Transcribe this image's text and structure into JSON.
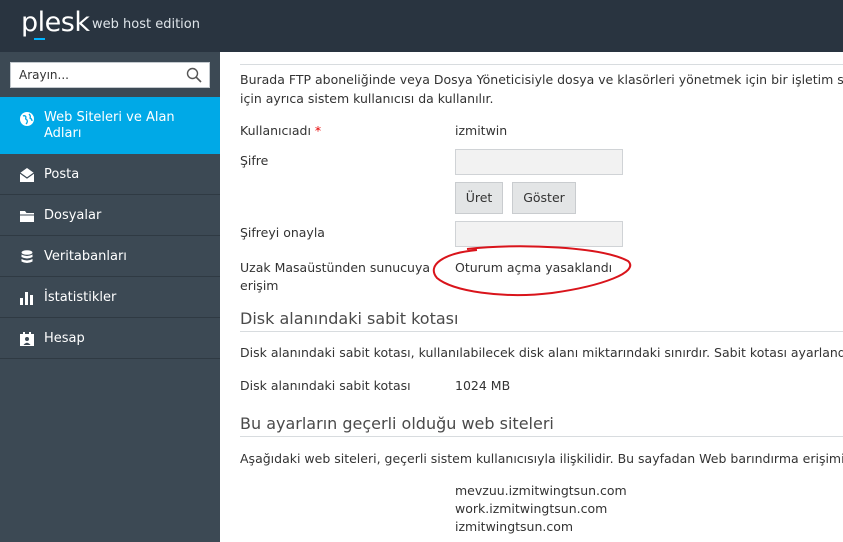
{
  "brand": {
    "logo": "plesk",
    "edition": "web host edition",
    "accent_color": "#00b3ff"
  },
  "sidebar": {
    "search_placeholder": "Arayın...",
    "items": [
      {
        "label": "Web Siteleri ve Alan Adları",
        "icon": "globe-icon",
        "active": true
      },
      {
        "label": "Posta",
        "icon": "mail-icon",
        "active": false
      },
      {
        "label": "Dosyalar",
        "icon": "folder-icon",
        "active": false
      },
      {
        "label": "Veritabanları",
        "icon": "database-icon",
        "active": false
      },
      {
        "label": "İstatistikler",
        "icon": "bar-chart-icon",
        "active": false
      },
      {
        "label": "Hesap",
        "icon": "account-icon",
        "active": false
      }
    ],
    "active_color": "#00a9e7"
  },
  "main": {
    "intro_line1": "Burada FTP aboneliğinde veya Dosya Yöneticisiyle dosya ve klasörleri yönetmek için bir işletim sisten",
    "intro_line2": "için ayrıca sistem kullanıcısı da kullanılır.",
    "username_label": "Kullanıcıadı",
    "required_mark": "*",
    "username_value": "izmitwin",
    "password_label": "Şifre",
    "generate_button": "Üret",
    "show_button": "Göster",
    "confirm_password_label": "Şifreyi onayla",
    "remote_access_label_line1": "Uzak Masaüstünden sunucuya",
    "remote_access_label_line2": "erişim",
    "remote_access_value": "Oturum açma yasaklandı",
    "disk_section_title": "Disk alanındaki sabit kotası",
    "disk_section_desc": "Disk alanındaki sabit kotası, kullanılabilecek disk alanı miktarındaki sınırdır. Sabit kotası ayarlandığın",
    "disk_quota_label": "Disk alanındaki sabit kotası",
    "disk_quota_value": "1024 MB",
    "sites_section_title": "Bu ayarların geçerli olduğu web siteleri",
    "sites_section_desc": "Aşağıdaki web siteleri, geçerli sistem kullanıcısıyla ilişkilidir. Bu sayfadan Web barındırma erişimi aya",
    "sites": [
      "mevzuu.izmitwingtsun.com",
      "work.izmitwingtsun.com",
      "izmitwingtsun.com"
    ],
    "annotation_color": "#d9141b"
  }
}
